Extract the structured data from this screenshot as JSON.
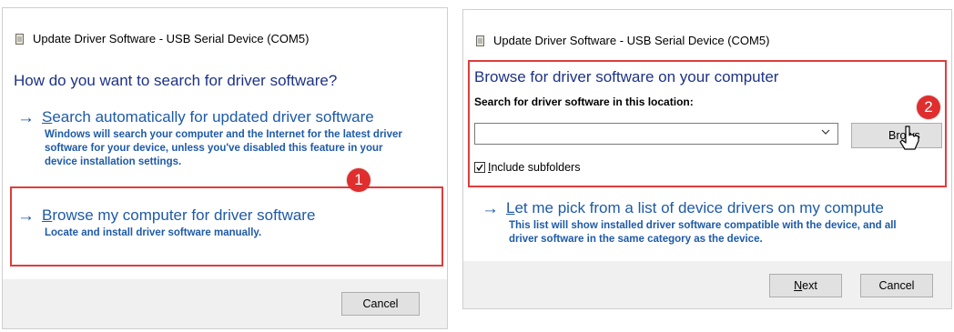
{
  "left_dialog": {
    "title": "Update Driver Software - USB Serial Device (COM5)",
    "heading": "How do you want to search for driver software?",
    "option_auto": {
      "title_first": "S",
      "title_rest": "earch automatically for updated driver software",
      "description": "Windows will search your computer and the Internet for the latest driver software for your device, unless you've disabled this feature in your device installation settings."
    },
    "option_browse": {
      "title_first": "B",
      "title_rest": "rowse my computer for driver software",
      "description": "Locate and install driver software manually."
    },
    "cancel_label": "Cancel",
    "badge": "1"
  },
  "right_dialog": {
    "title": "Update Driver Software - USB Serial Device (COM5)",
    "heading": "Browse for driver software on your computer",
    "search_label": "Search for driver software in this location:",
    "location_value": "",
    "browse_label": "Brows",
    "include_subfolders_first": "I",
    "include_subfolders_rest": "nclude subfolders",
    "include_subfolders_checked": "☑",
    "option_pick": {
      "title_first": "L",
      "title_rest": "et me pick from a list of device drivers on my compute",
      "description": "This list will show installed driver software compatible with the device, and all driver software in the same category as the device."
    },
    "next_first": "N",
    "next_rest": "ext",
    "cancel_label": "Cancel",
    "badge": "2"
  },
  "colors": {
    "link": "#1e5aa8",
    "heading": "#1e3287",
    "highlight_box": "#e03c3c",
    "badge": "#e02e2e",
    "footer": "#f0f0f0"
  }
}
